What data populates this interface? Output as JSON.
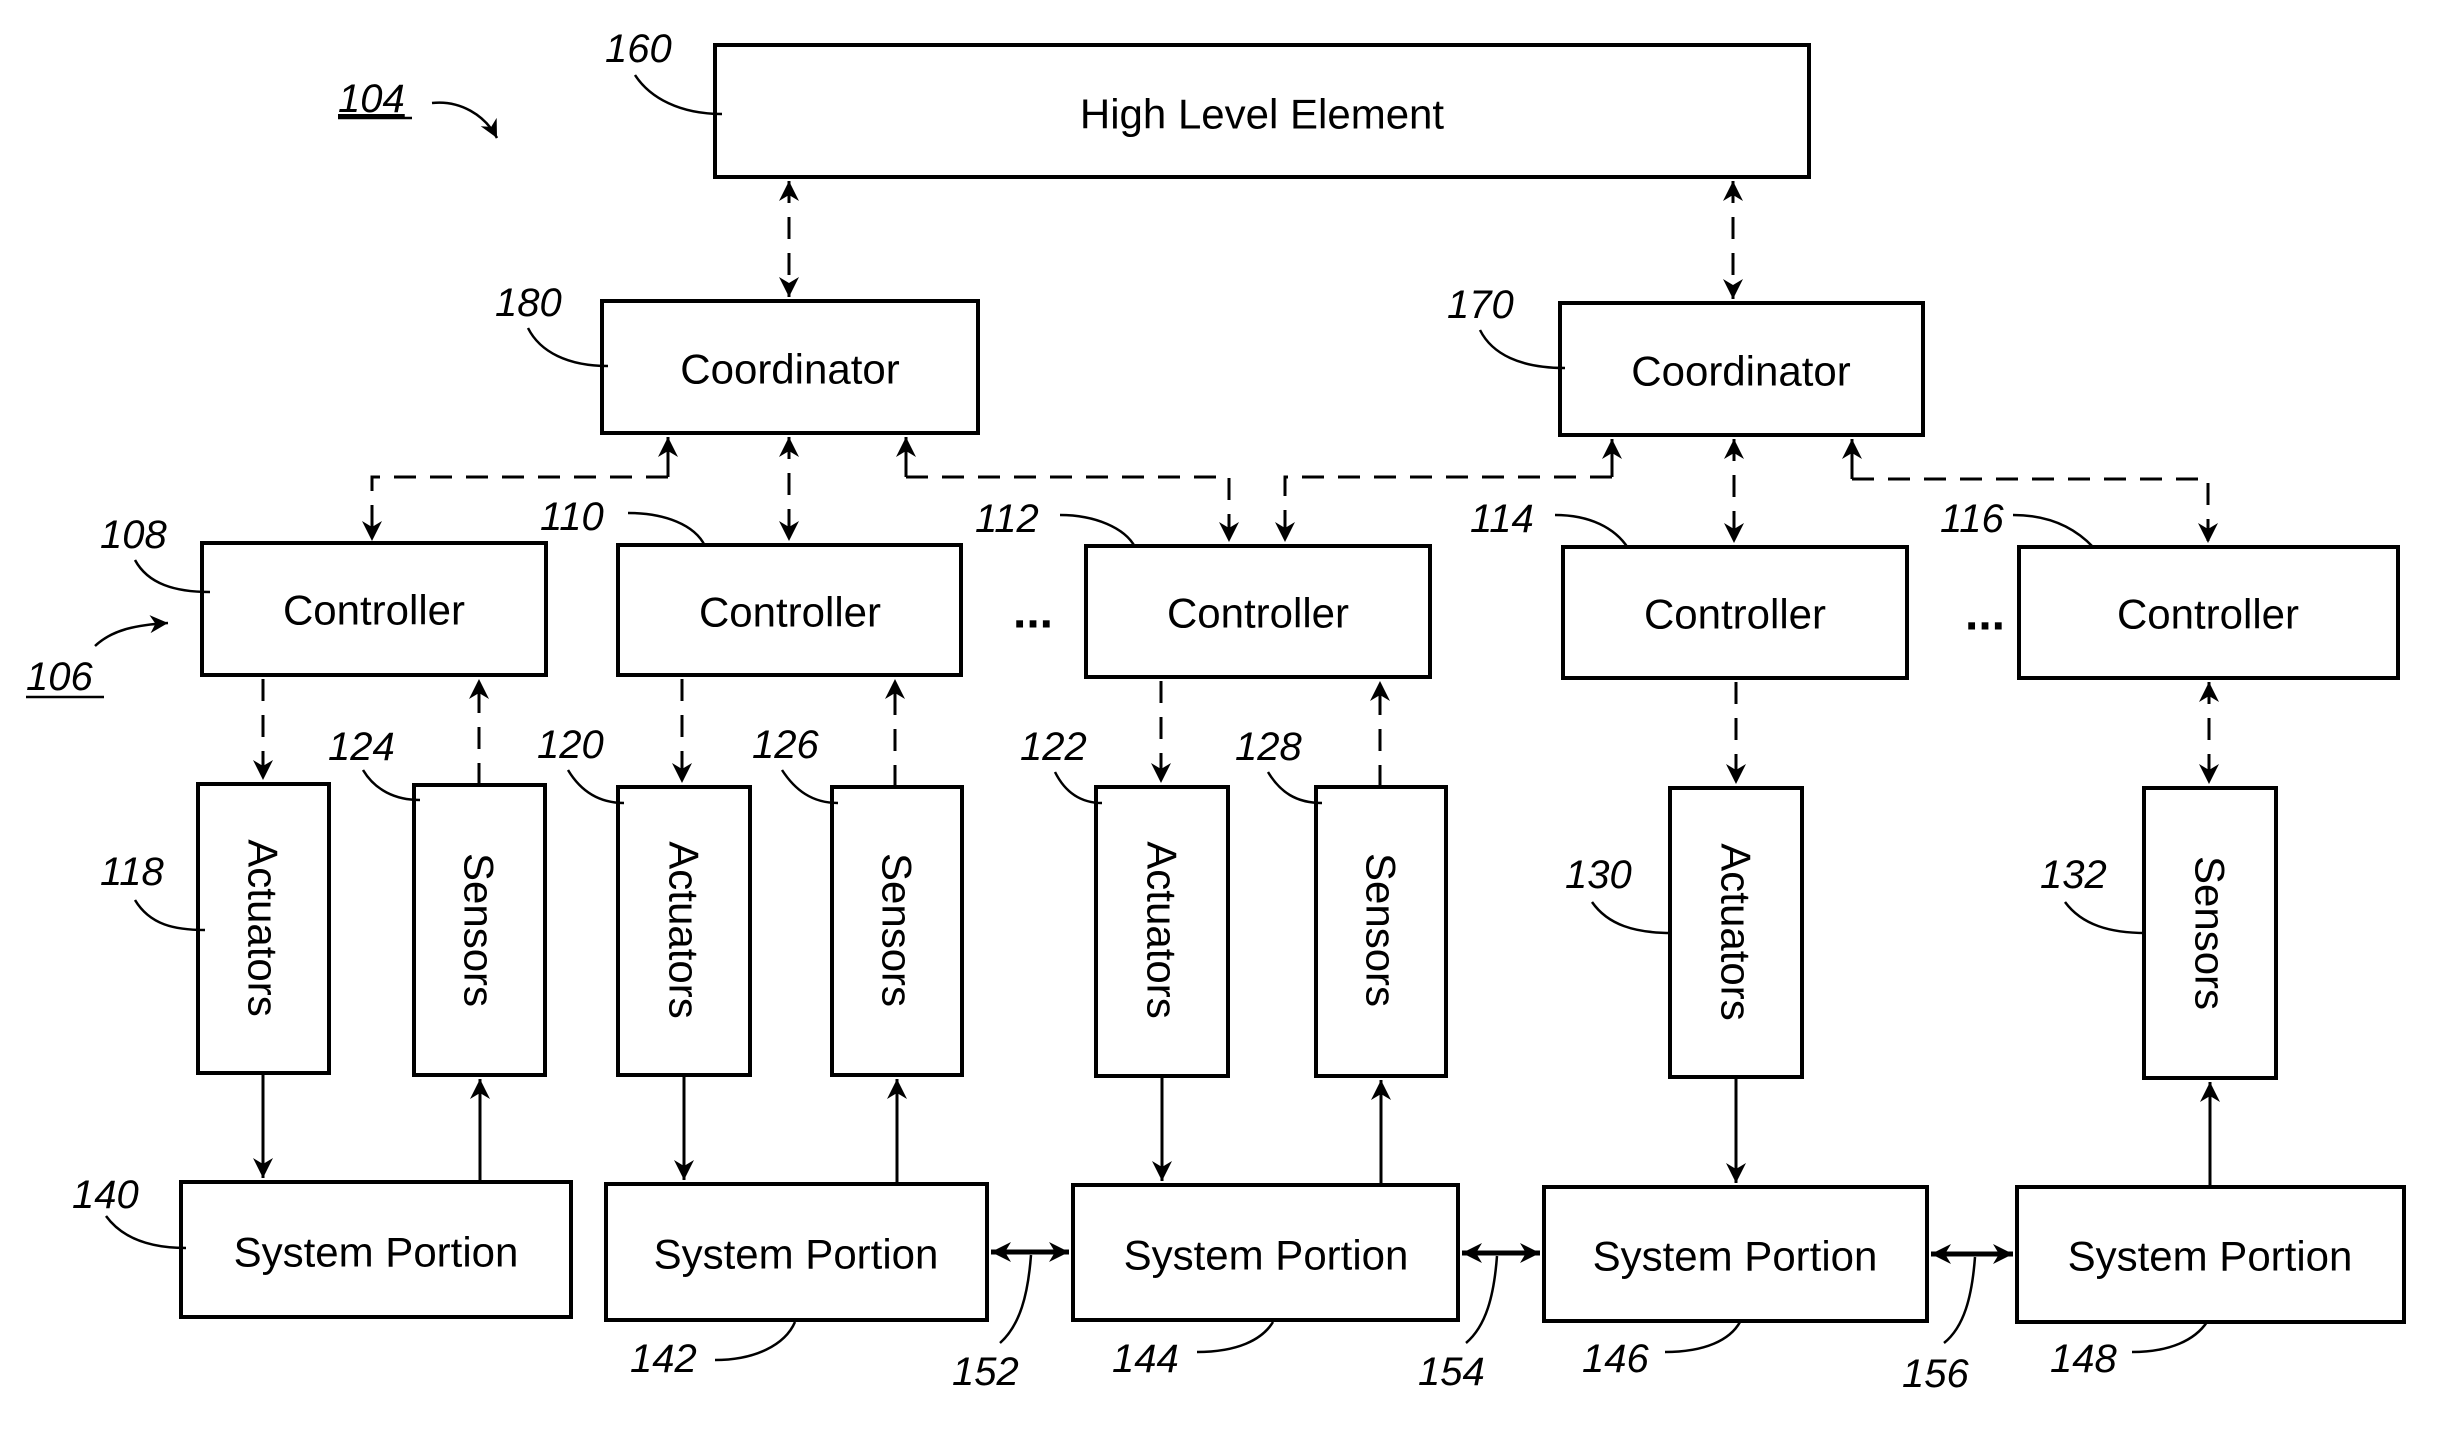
{
  "figure": {
    "ref_system": "104",
    "ref_group": "106"
  },
  "colors": {
    "ink": "#000000",
    "paper": "#ffffff"
  },
  "high_level": {
    "id": "160",
    "label": "High Level Element"
  },
  "coordinators": [
    {
      "id": "180",
      "label": "Coordinator"
    },
    {
      "id": "170",
      "label": "Coordinator"
    }
  ],
  "controllers": [
    {
      "id": "108",
      "label": "Controller"
    },
    {
      "id": "110",
      "label": "Controller"
    },
    {
      "id": "112",
      "label": "Controller"
    },
    {
      "id": "114",
      "label": "Controller"
    },
    {
      "id": "116",
      "label": "Controller"
    }
  ],
  "ellipsis": "...",
  "devices": [
    {
      "id": "118",
      "label": "Actuators"
    },
    {
      "id": "124",
      "label": "Sensors"
    },
    {
      "id": "120",
      "label": "Actuators"
    },
    {
      "id": "126",
      "label": "Sensors"
    },
    {
      "id": "122",
      "label": "Actuators"
    },
    {
      "id": "128",
      "label": "Sensors"
    },
    {
      "id": "130",
      "label": "Actuators"
    },
    {
      "id": "132",
      "label": "Sensors"
    }
  ],
  "system_portions": [
    {
      "id": "140",
      "label": "System Portion"
    },
    {
      "id": "142",
      "label": "System Portion"
    },
    {
      "id": "144",
      "label": "System Portion"
    },
    {
      "id": "146",
      "label": "System Portion"
    },
    {
      "id": "148",
      "label": "System Portion"
    }
  ],
  "couplings": [
    {
      "id": "152"
    },
    {
      "id": "154"
    },
    {
      "id": "156"
    }
  ]
}
